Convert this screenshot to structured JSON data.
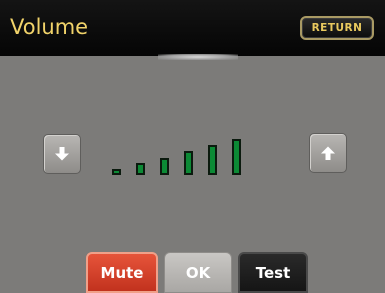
{
  "header": {
    "title": "Volume",
    "return_label": "RETURN"
  },
  "volume": {
    "level": 6,
    "max_level": 6
  },
  "controls": {
    "down_icon": "arrow-down-icon",
    "up_icon": "arrow-up-icon"
  },
  "buttons": {
    "mute_label": "Mute",
    "ok_label": "OK",
    "test_label": "Test"
  },
  "colors": {
    "title": "#f1d36a",
    "bar_fill": "#0c8a35",
    "mute": "#d8442c",
    "panel": "#7c7b79"
  }
}
